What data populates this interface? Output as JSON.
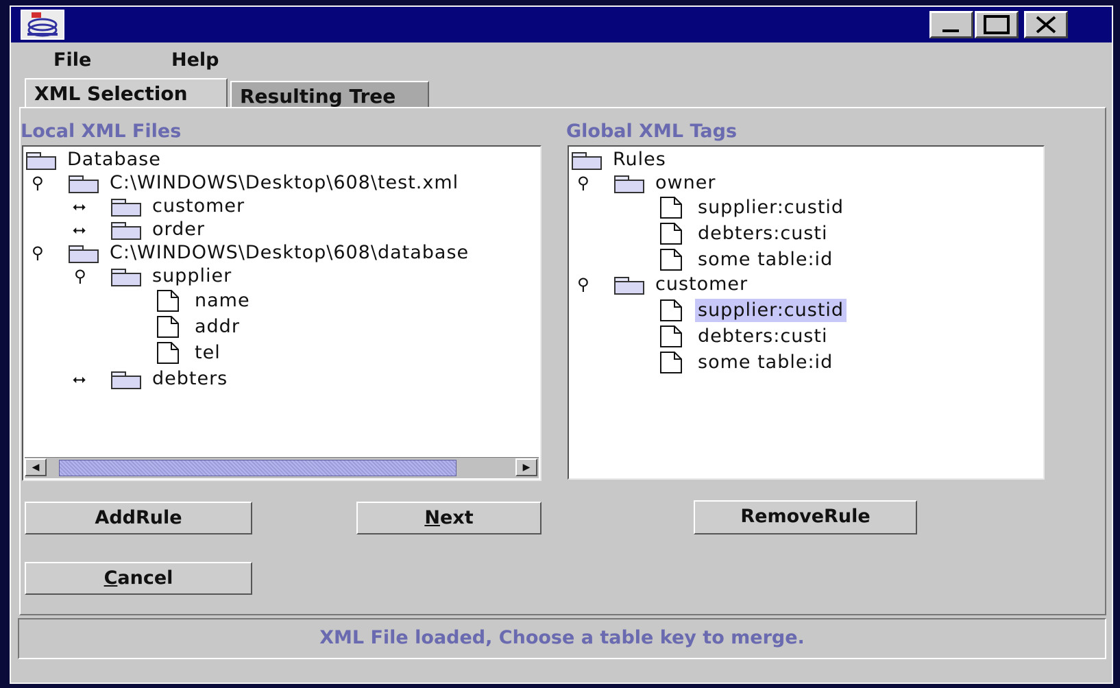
{
  "window": {
    "app_icon": "java-cup-icon",
    "controls": {
      "minimize": "minimize-icon",
      "maximize": "maximize-icon",
      "close": "close-icon"
    }
  },
  "menu": {
    "file": "File",
    "help": "Help"
  },
  "tabs": [
    {
      "label": "XML Selection",
      "selected": true
    },
    {
      "label": "Resulting Tree",
      "selected": false
    }
  ],
  "local_files": {
    "title": "Local XML Files",
    "tree": {
      "root": "Database",
      "file1": "C:\\WINDOWS\\Desktop\\608\\test.xml",
      "file1_children": [
        "customer",
        "order"
      ],
      "file2": "C:\\WINDOWS\\Desktop\\608\\database",
      "supplier": "supplier",
      "supplier_fields": [
        "name",
        "addr",
        "tel"
      ],
      "debters": "debters"
    },
    "scroll_position": 0.83
  },
  "global_tags": {
    "title": "Global XML Tags",
    "tree": {
      "root": "Rules",
      "owner": "owner",
      "owner_items": [
        "supplier:custid",
        "debters:custi",
        "some table:id"
      ],
      "customer": "customer",
      "customer_items": [
        "supplier:custid",
        "debters:custi",
        "some table:id"
      ],
      "selected": "customer/supplier:custid"
    }
  },
  "buttons": {
    "add_rule": "AddRule",
    "next_mnemonic": "N",
    "next_rest": "ext",
    "remove_rule": "RemoveRule",
    "cancel_mnemonic": "C",
    "cancel_rest": "ancel"
  },
  "status": "XML File loaded, Choose a table key to merge.",
  "colors": {
    "titlebar": "#06067a",
    "window_bg": "#c8c8c8",
    "label_accent": "#6a6ab0",
    "selection": "#c8c8f8"
  }
}
